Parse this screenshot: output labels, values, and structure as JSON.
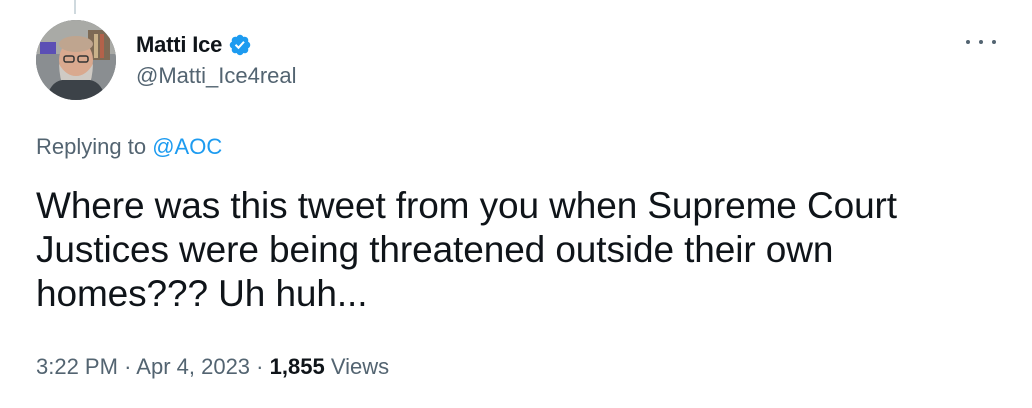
{
  "author": {
    "display_name": "Matti Ice",
    "handle": "@Matti_Ice4real",
    "verified": true
  },
  "reply": {
    "prefix": "Replying to",
    "mention": "@AOC"
  },
  "tweet": {
    "text": "Where was this tweet from you when Supreme Court Justices were being threatened outside their own homes??? Uh huh..."
  },
  "meta": {
    "time": "3:22 PM",
    "separator": "·",
    "date": "Apr 4, 2023",
    "views_count": "1,855",
    "views_label": "Views"
  },
  "icons": {
    "verified": "verified-badge-icon",
    "more": "more-options-icon"
  },
  "colors": {
    "link": "#1d9bf0",
    "secondary_text": "#536471",
    "primary_text": "#0f1419",
    "verified_badge": "#1d9bf0"
  }
}
